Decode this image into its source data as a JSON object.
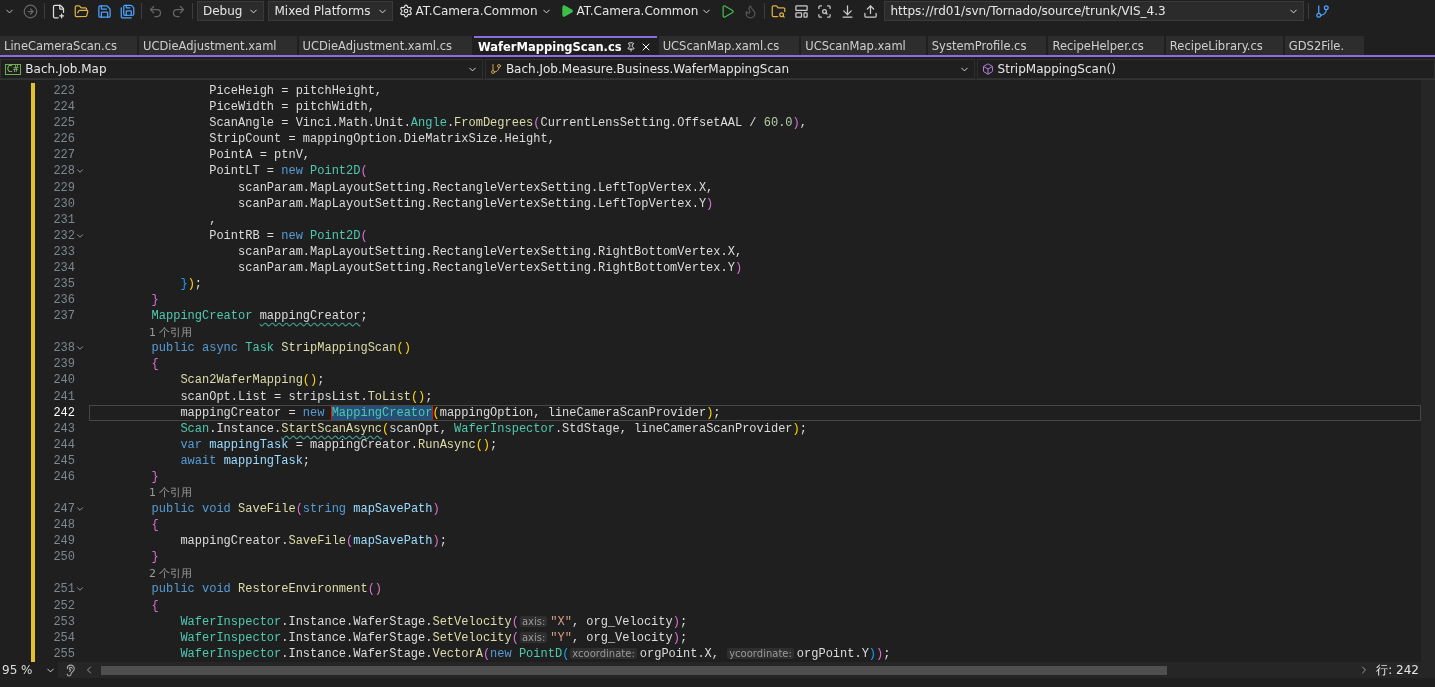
{
  "toolbar": {
    "configuration": "Debug",
    "platform": "Mixed Platforms",
    "startup_project": "AT.Camera.Common",
    "run_target": "AT.Camera.Common",
    "source_url": "https://rd01/svn/Tornado/source/trunk/VIS_4.3"
  },
  "tabs": [
    {
      "label": "LineCameraScan.cs",
      "selected": false
    },
    {
      "label": "UCDieAdjustment.xaml",
      "selected": false
    },
    {
      "label": "UCDieAdjustment.xaml.cs",
      "selected": false
    },
    {
      "label": "WaferMappingScan.cs",
      "selected": true
    },
    {
      "label": "UCScanMap.xaml.cs",
      "selected": false
    },
    {
      "label": "UCScanMap.xaml",
      "selected": false
    },
    {
      "label": "SystemProfile.cs",
      "selected": false
    },
    {
      "label": "RecipeHelper.cs",
      "selected": false
    },
    {
      "label": "RecipeLibrary.cs",
      "selected": false
    },
    {
      "label": "GDS2File.",
      "selected": false
    }
  ],
  "navigation": {
    "project_badge": "C#",
    "project": "Bach.Job.Map",
    "type": "Bach.Job.Measure.Business.WaferMappingScan",
    "member": "StripMappingScan()"
  },
  "editor": {
    "rows": [
      {
        "kind": "code",
        "num": "223",
        "fold": false,
        "current": false,
        "tokens": [
          {
            "kind": "p",
            "text": "                PiceHeigh = pitchHeight,"
          }
        ]
      },
      {
        "kind": "code",
        "num": "224",
        "fold": false,
        "current": false,
        "tokens": [
          {
            "kind": "p",
            "text": "                PiceWidth = pitchWidth,"
          }
        ]
      },
      {
        "kind": "code",
        "num": "225",
        "fold": false,
        "current": false,
        "tokens": [
          {
            "kind": "p",
            "text": "                ScanAngle = Vinci.Math.Unit."
          },
          {
            "kind": "t",
            "text": "Angle"
          },
          {
            "kind": "p",
            "text": "."
          },
          {
            "kind": "m",
            "text": "FromDegrees"
          },
          {
            "kind": "b2",
            "text": "("
          },
          {
            "kind": "p",
            "text": "CurrentLensSetting.OffsetAAL / "
          },
          {
            "kind": "n",
            "text": "60.0"
          },
          {
            "kind": "b2",
            "text": ")"
          },
          {
            "kind": "p",
            "text": ","
          }
        ]
      },
      {
        "kind": "code",
        "num": "226",
        "fold": false,
        "current": false,
        "tokens": [
          {
            "kind": "p",
            "text": "                StripCount = mappingOption.DieMatrixSize.Height,"
          }
        ]
      },
      {
        "kind": "code",
        "num": "227",
        "fold": false,
        "current": false,
        "tokens": [
          {
            "kind": "p",
            "text": "                PointA = ptnV,"
          }
        ]
      },
      {
        "kind": "code",
        "num": "228",
        "fold": true,
        "current": false,
        "tokens": [
          {
            "kind": "p",
            "text": "                PointLT = "
          },
          {
            "kind": "k",
            "text": "new "
          },
          {
            "kind": "t",
            "text": "Point2D"
          },
          {
            "kind": "b2",
            "text": "("
          }
        ]
      },
      {
        "kind": "code",
        "num": "229",
        "fold": false,
        "current": false,
        "tokens": [
          {
            "kind": "p",
            "text": "                    scanParam.MapLayoutSetting.RectangleVertexSetting.LeftTopVertex.X,"
          }
        ]
      },
      {
        "kind": "code",
        "num": "230",
        "fold": false,
        "current": false,
        "tokens": [
          {
            "kind": "p",
            "text": "                    scanParam.MapLayoutSetting.RectangleVertexSetting.LeftTopVertex.Y"
          },
          {
            "kind": "b2",
            "text": ")"
          }
        ]
      },
      {
        "kind": "code",
        "num": "231",
        "fold": false,
        "current": false,
        "tokens": [
          {
            "kind": "p",
            "text": "                ,"
          }
        ]
      },
      {
        "kind": "code",
        "num": "232",
        "fold": true,
        "current": false,
        "tokens": [
          {
            "kind": "p",
            "text": "                PointRB = "
          },
          {
            "kind": "k",
            "text": "new "
          },
          {
            "kind": "t",
            "text": "Point2D"
          },
          {
            "kind": "b2",
            "text": "("
          }
        ]
      },
      {
        "kind": "code",
        "num": "233",
        "fold": false,
        "current": false,
        "tokens": [
          {
            "kind": "p",
            "text": "                    scanParam.MapLayoutSetting.RectangleVertexSetting.RightBottomVertex.X,"
          }
        ]
      },
      {
        "kind": "code",
        "num": "234",
        "fold": false,
        "current": false,
        "tokens": [
          {
            "kind": "p",
            "text": "                    scanParam.MapLayoutSetting.RectangleVertexSetting.RightBottomVertex.Y"
          },
          {
            "kind": "b2",
            "text": ")"
          }
        ]
      },
      {
        "kind": "code",
        "num": "235",
        "fold": false,
        "current": false,
        "tokens": [
          {
            "kind": "b3",
            "text": "            }"
          },
          {
            "kind": "b1",
            "text": ")"
          },
          {
            "kind": "p",
            "text": ";"
          }
        ]
      },
      {
        "kind": "code",
        "num": "236",
        "fold": false,
        "current": false,
        "tokens": [
          {
            "kind": "b2",
            "text": "        }"
          }
        ]
      },
      {
        "kind": "code",
        "num": "237",
        "fold": false,
        "current": false,
        "tokens": [
          {
            "kind": "t",
            "text": "        MappingCreator "
          },
          {
            "kind": "psq",
            "text": "mappingCreator"
          },
          {
            "kind": "p",
            "text": ";"
          }
        ]
      },
      {
        "kind": "codelens",
        "text": "1 个引用"
      },
      {
        "kind": "code",
        "num": "238",
        "fold": true,
        "current": false,
        "tokens": [
          {
            "kind": "k",
            "text": "        public async "
          },
          {
            "kind": "t",
            "text": "Task "
          },
          {
            "kind": "m",
            "text": "StripMappingScan"
          },
          {
            "kind": "b1",
            "text": "()"
          }
        ]
      },
      {
        "kind": "code",
        "num": "239",
        "fold": false,
        "current": false,
        "tokens": [
          {
            "kind": "b2",
            "text": "        {"
          }
        ]
      },
      {
        "kind": "code",
        "num": "240",
        "fold": false,
        "current": false,
        "tokens": [
          {
            "kind": "m",
            "text": "            Scan2WaferMapping"
          },
          {
            "kind": "b1",
            "text": "()"
          },
          {
            "kind": "p",
            "text": ";"
          }
        ]
      },
      {
        "kind": "code",
        "num": "241",
        "fold": false,
        "current": false,
        "tokens": [
          {
            "kind": "p",
            "text": "            scanOpt.List = stripsList."
          },
          {
            "kind": "m",
            "text": "ToList"
          },
          {
            "kind": "b1",
            "text": "()"
          },
          {
            "kind": "p",
            "text": ";"
          }
        ]
      },
      {
        "kind": "code",
        "num": "242",
        "fold": false,
        "current": true,
        "tokens": [
          {
            "kind": "p",
            "text": "            mappingCreator = "
          },
          {
            "kind": "k",
            "text": "new "
          },
          {
            "kind": "sel",
            "text": "MappingCreator"
          },
          {
            "kind": "b1",
            "text": "("
          },
          {
            "kind": "p",
            "text": "mappingOption, lineCameraScanProvider"
          },
          {
            "kind": "b1",
            "text": ")"
          },
          {
            "kind": "p",
            "text": ";"
          }
        ]
      },
      {
        "kind": "code",
        "num": "243",
        "fold": false,
        "current": false,
        "tokens": [
          {
            "kind": "t",
            "text": "            Scan"
          },
          {
            "kind": "p",
            "text": ".Instance."
          },
          {
            "kind": "msq",
            "text": "StartScanAsync"
          },
          {
            "kind": "b1",
            "text": "("
          },
          {
            "kind": "p",
            "text": "scanOpt, "
          },
          {
            "kind": "t",
            "text": "WaferInspector"
          },
          {
            "kind": "p",
            "text": ".StdStage, lineCameraScanProvider"
          },
          {
            "kind": "b1",
            "text": ")"
          },
          {
            "kind": "p",
            "text": ";"
          }
        ]
      },
      {
        "kind": "code",
        "num": "244",
        "fold": false,
        "current": false,
        "tokens": [
          {
            "kind": "k",
            "text": "            var "
          },
          {
            "kind": "v",
            "text": "mappingTask"
          },
          {
            "kind": "p",
            "text": " = mappingCreator."
          },
          {
            "kind": "m",
            "text": "RunAsync"
          },
          {
            "kind": "b1",
            "text": "()"
          },
          {
            "kind": "p",
            "text": ";"
          }
        ]
      },
      {
        "kind": "code",
        "num": "245",
        "fold": false,
        "current": false,
        "tokens": [
          {
            "kind": "k",
            "text": "            await "
          },
          {
            "kind": "v",
            "text": "mappingTask"
          },
          {
            "kind": "p",
            "text": ";"
          }
        ]
      },
      {
        "kind": "code",
        "num": "246",
        "fold": false,
        "current": false,
        "tokens": [
          {
            "kind": "b2",
            "text": "        }"
          }
        ]
      },
      {
        "kind": "codelens",
        "text": "1 个引用"
      },
      {
        "kind": "code",
        "num": "247",
        "fold": true,
        "current": false,
        "tokens": [
          {
            "kind": "k",
            "text": "        public void "
          },
          {
            "kind": "m",
            "text": "SaveFile"
          },
          {
            "kind": "b2",
            "text": "("
          },
          {
            "kind": "k",
            "text": "string "
          },
          {
            "kind": "v",
            "text": "mapSavePath"
          },
          {
            "kind": "b2",
            "text": ")"
          }
        ]
      },
      {
        "kind": "code",
        "num": "248",
        "fold": false,
        "current": false,
        "tokens": [
          {
            "kind": "b2",
            "text": "        {"
          }
        ]
      },
      {
        "kind": "code",
        "num": "249",
        "fold": false,
        "current": false,
        "tokens": [
          {
            "kind": "p",
            "text": "            mappingCreator."
          },
          {
            "kind": "m",
            "text": "SaveFile"
          },
          {
            "kind": "b2",
            "text": "("
          },
          {
            "kind": "v",
            "text": "mapSavePath"
          },
          {
            "kind": "b2",
            "text": ")"
          },
          {
            "kind": "p",
            "text": ";"
          }
        ]
      },
      {
        "kind": "code",
        "num": "250",
        "fold": false,
        "current": false,
        "tokens": [
          {
            "kind": "b2",
            "text": "        }"
          }
        ]
      },
      {
        "kind": "codelens",
        "text": "2 个引用"
      },
      {
        "kind": "code",
        "num": "251",
        "fold": true,
        "current": false,
        "tokens": [
          {
            "kind": "k",
            "text": "        public void "
          },
          {
            "kind": "m",
            "text": "RestoreEnvironment"
          },
          {
            "kind": "b2",
            "text": "()"
          }
        ]
      },
      {
        "kind": "code",
        "num": "252",
        "fold": false,
        "current": false,
        "tokens": [
          {
            "kind": "b2",
            "text": "        {"
          }
        ]
      },
      {
        "kind": "code",
        "num": "253",
        "fold": false,
        "current": false,
        "tokens": [
          {
            "kind": "t",
            "text": "            WaferInspector"
          },
          {
            "kind": "p",
            "text": ".Instance.WaferStage."
          },
          {
            "kind": "m",
            "text": "SetVelocity"
          },
          {
            "kind": "b2",
            "text": "("
          },
          {
            "kind": "h",
            "text": "axis:"
          },
          {
            "kind": "s",
            "text": "\"X\""
          },
          {
            "kind": "p",
            "text": ", org_Velocity"
          },
          {
            "kind": "b2",
            "text": ")"
          },
          {
            "kind": "p",
            "text": ";"
          }
        ]
      },
      {
        "kind": "code",
        "num": "254",
        "fold": false,
        "current": false,
        "tokens": [
          {
            "kind": "t",
            "text": "            WaferInspector"
          },
          {
            "kind": "p",
            "text": ".Instance.WaferStage."
          },
          {
            "kind": "m",
            "text": "SetVelocity"
          },
          {
            "kind": "b2",
            "text": "("
          },
          {
            "kind": "h",
            "text": "axis:"
          },
          {
            "kind": "s",
            "text": "\"Y\""
          },
          {
            "kind": "p",
            "text": ", org_Velocity"
          },
          {
            "kind": "b2",
            "text": ")"
          },
          {
            "kind": "p",
            "text": ";"
          }
        ]
      },
      {
        "kind": "code",
        "num": "255",
        "fold": false,
        "current": false,
        "tokens": [
          {
            "kind": "t",
            "text": "            WaferInspector"
          },
          {
            "kind": "p",
            "text": ".Instance.WaferStage."
          },
          {
            "kind": "m",
            "text": "VectorA"
          },
          {
            "kind": "b2",
            "text": "("
          },
          {
            "kind": "k",
            "text": "new "
          },
          {
            "kind": "t",
            "text": "PointD"
          },
          {
            "kind": "b3",
            "text": "("
          },
          {
            "kind": "h",
            "text": "xcoordinate:"
          },
          {
            "kind": "p",
            "text": "orgPoint.X, "
          },
          {
            "kind": "h",
            "text": "ycoordinate:"
          },
          {
            "kind": "p",
            "text": "orgPoint.Y"
          },
          {
            "kind": "b3",
            "text": ")"
          },
          {
            "kind": "b2",
            "text": ")"
          },
          {
            "kind": "p",
            "text": ";"
          }
        ]
      }
    ]
  },
  "status": {
    "zoom": "95 %",
    "line": "行: 242"
  }
}
